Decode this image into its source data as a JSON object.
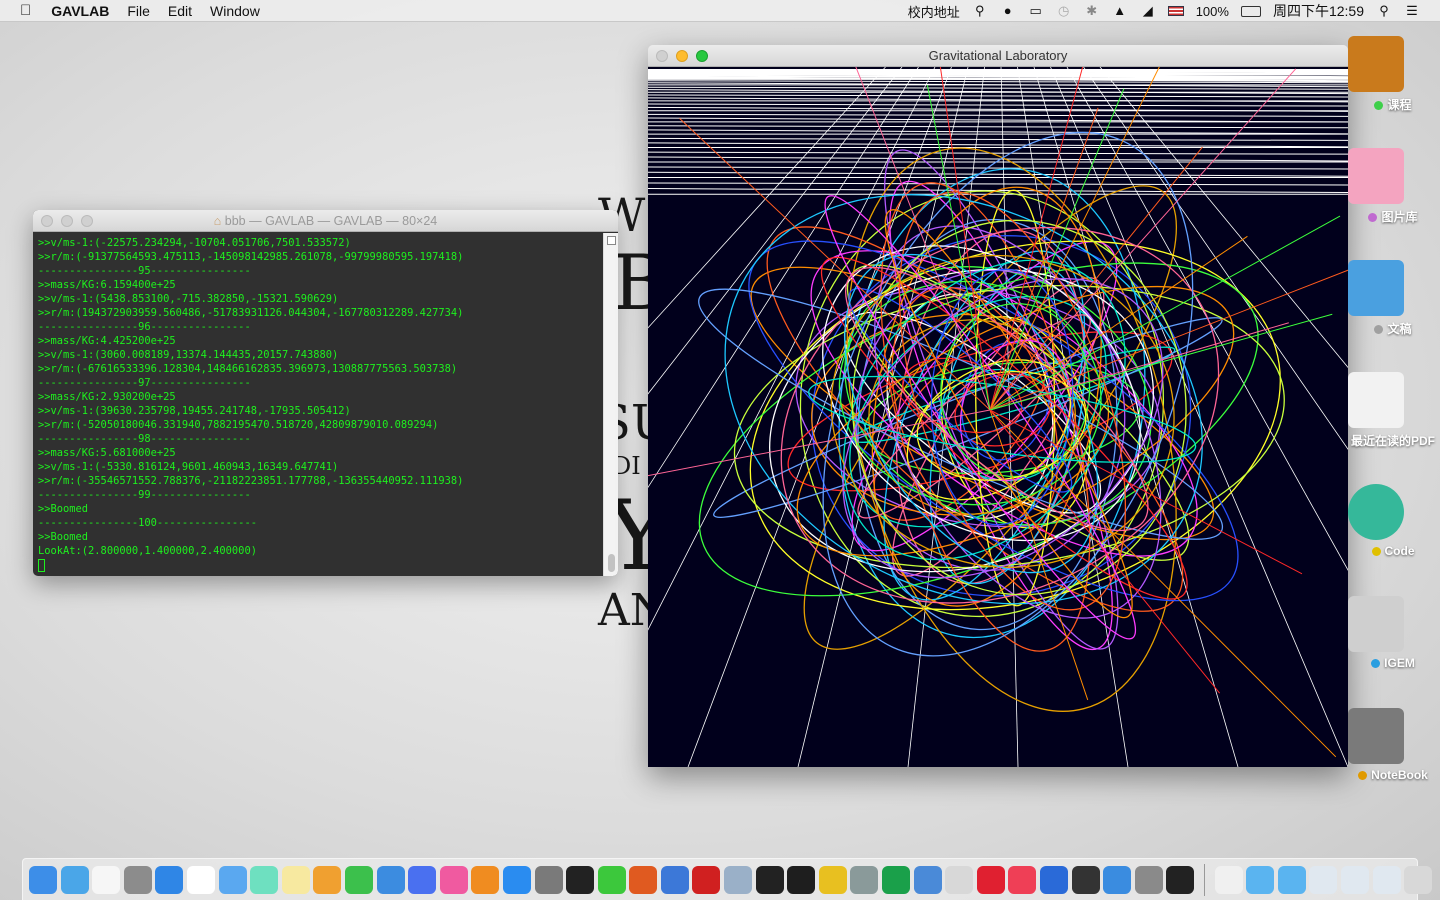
{
  "menubar": {
    "app": "GAVLAB",
    "items": [
      "File",
      "Edit",
      "Window"
    ],
    "status": {
      "network": "校内地址",
      "battery": "100%",
      "clock": "周四下午12:59"
    }
  },
  "background_text": [
    "W",
    "B",
    "SU",
    "DI",
    "Y",
    "AN"
  ],
  "terminal": {
    "title": "bbb — GAVLAB — GAVLAB — 80×24",
    "lines": [
      ">>v/ms-1:(-22575.234294,-10704.051706,7501.533572)",
      ">>r/m:(-91377564593.475113,-145098142985.261078,-99799980595.197418)",
      "----------------95----------------",
      ">>mass/KG:6.159400e+25",
      ">>v/ms-1:(5438.853100,-715.382850,-15321.590629)",
      ">>r/m:(194372903959.560486,-51783931126.044304,-167780312289.427734)",
      "----------------96----------------",
      ">>mass/KG:4.425200e+25",
      ">>v/ms-1:(3060.008189,13374.144435,20157.743880)",
      ">>r/m:(-67616533396.128304,148466162835.396973,130887775563.503738)",
      "----------------97----------------",
      ">>mass/KG:2.930200e+25",
      ">>v/ms-1:(39630.235798,19455.241748,-17935.505412)",
      ">>r/m:(-52050180046.331940,7882195470.518720,42809879010.089294)",
      "----------------98----------------",
      ">>mass/KG:5.681000e+25",
      ">>v/ms-1:(-5330.816124,9601.460943,16349.647741)",
      ">>r/m:(-35546571552.788376,-21182223851.177788,-136355440952.111938)",
      "----------------99----------------",
      ">>Boomed",
      "----------------100----------------",
      ">>Boomed",
      "LookAt:(2.800000,1.400000,2.400000)"
    ]
  },
  "gl_window": {
    "title": "Gravitational Laboratory",
    "orbit_colors": [
      "#ff5a1e",
      "#1ec8ff",
      "#ff3cff",
      "#3cff3c",
      "#ffff28",
      "#2850ff",
      "#ff8c00",
      "#b45aff",
      "#00e6c8",
      "#ff6496",
      "#c8ff3c",
      "#ffffff",
      "#ff2828",
      "#64a0ff",
      "#e6a000"
    ],
    "background": "#01001c"
  },
  "desktop_icons": [
    {
      "label": "课程",
      "dot": "#3ecf4a",
      "color": "#c97a1c"
    },
    {
      "label": "图片库",
      "dot": "#c06ad0",
      "color": "#f4a4c0"
    },
    {
      "label": "文稿",
      "dot": "#a0a0a0",
      "color": "#4aa0e0"
    },
    {
      "label": "最近在读的PDF",
      "dot": "",
      "color": "#f2f2f2"
    },
    {
      "label": "Code",
      "dot": "#e0c000",
      "color": "#35b89a"
    },
    {
      "label": "IGEM",
      "dot": "#2a9ee0",
      "color": "#cfcfcf"
    },
    {
      "label": "NoteBook",
      "dot": "#e09a00",
      "color": "#7a7a7a"
    }
  ],
  "dock": [
    {
      "name": "finder-icon",
      "color": "#3d8ee8"
    },
    {
      "name": "launchpad-icon",
      "color": "#4aa6e8"
    },
    {
      "name": "calendar-icon",
      "color": "#f6f6f6"
    },
    {
      "name": "rocket-icon",
      "color": "#8c8c8c"
    },
    {
      "name": "safari-icon",
      "color": "#2f86e6"
    },
    {
      "name": "clock-icon",
      "color": "#ffffff"
    },
    {
      "name": "mail-icon",
      "color": "#5aa8f0"
    },
    {
      "name": "siri-icon",
      "color": "#6ee0c0"
    },
    {
      "name": "notes-icon",
      "color": "#f7e9a0"
    },
    {
      "name": "pages-icon",
      "color": "#f0a030"
    },
    {
      "name": "numbers-icon",
      "color": "#3cc04c"
    },
    {
      "name": "keynote-icon",
      "color": "#3c8ce0"
    },
    {
      "name": "siri-blue-icon",
      "color": "#4a70f0"
    },
    {
      "name": "itunes-icon",
      "color": "#f05aa0"
    },
    {
      "name": "ibooks-icon",
      "color": "#f08c20"
    },
    {
      "name": "app-store-icon",
      "color": "#2a8cf0"
    },
    {
      "name": "system-preferences-icon",
      "color": "#7a7a7a"
    },
    {
      "name": "qq-icon",
      "color": "#222222"
    },
    {
      "name": "wechat-icon",
      "color": "#3cc83c"
    },
    {
      "name": "matlab-icon",
      "color": "#e05a20"
    },
    {
      "name": "xcode-icon",
      "color": "#3c78d8"
    },
    {
      "name": "wps-icon",
      "color": "#d02020"
    },
    {
      "name": "preview-icon",
      "color": "#9ab0c8"
    },
    {
      "name": "activity-monitor-icon",
      "color": "#222222"
    },
    {
      "name": "terminal-icon",
      "color": "#1e1e1e"
    },
    {
      "name": "tencent-icon",
      "color": "#e8c020"
    },
    {
      "name": "tex-icon",
      "color": "#8a9a9a"
    },
    {
      "name": "pycharm-icon",
      "color": "#1aa04a"
    },
    {
      "name": "instruments-icon",
      "color": "#4a8ad8"
    },
    {
      "name": "crossover-icon",
      "color": "#d8d8d8"
    },
    {
      "name": "opera-icon",
      "color": "#e02030"
    },
    {
      "name": "pocket-icon",
      "color": "#ef3f56"
    },
    {
      "name": "q-icon",
      "color": "#2a6ad8"
    },
    {
      "name": "arrow-up-icon",
      "color": "#333333"
    },
    {
      "name": "network-icon",
      "color": "#3a8ce0"
    },
    {
      "name": "disk-utility-icon",
      "color": "#8a8a8a"
    },
    {
      "name": "console-icon",
      "color": "#222222"
    },
    {
      "sep": true
    },
    {
      "name": "document-icon",
      "color": "#f0f0f0"
    },
    {
      "name": "folder-icon",
      "color": "#5ab4f0"
    },
    {
      "name": "folder-icon",
      "color": "#5ab4f0"
    },
    {
      "name": "screenshot-icon",
      "color": "#e0e8f0"
    },
    {
      "name": "screenshot-icon",
      "color": "#e0e8f0"
    },
    {
      "name": "screenshot-icon",
      "color": "#e0e8f0"
    },
    {
      "name": "trash-icon",
      "color": "#d8d8d8"
    }
  ]
}
